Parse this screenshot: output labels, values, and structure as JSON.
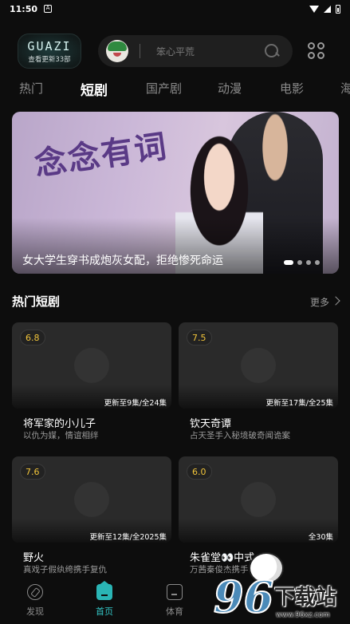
{
  "status_bar": {
    "time": "11:50",
    "notif_letter": "A"
  },
  "header": {
    "logo_text": "GUAZI",
    "logo_sub": "查看更新33部",
    "search_placeholder": "笨心平荒"
  },
  "tabs": [
    {
      "label": "热门",
      "active": false
    },
    {
      "label": "短剧",
      "active": true
    },
    {
      "label": "国产剧",
      "active": false
    },
    {
      "label": "动漫",
      "active": false
    },
    {
      "label": "电影",
      "active": false
    },
    {
      "label": "海",
      "active": false
    }
  ],
  "banner": {
    "art_title": "念念有词",
    "caption": "女大学生穿书成炮灰女配，拒绝惨死命运",
    "slide_count": 4,
    "active_slide": 1
  },
  "section": {
    "title": "热门短剧",
    "more": "更多"
  },
  "cards": [
    {
      "score": "6.8",
      "episodes": "更新至9集/全24集",
      "title": "将军家的小儿子",
      "desc": "以仇为媒，情谊相绊"
    },
    {
      "score": "7.5",
      "episodes": "更新至17集/全25集",
      "title": "钦天奇谭",
      "desc": "占天圣手入秘境破奇闻诡案"
    },
    {
      "score": "7.6",
      "episodes": "更新至12集/全2025集",
      "title": "野火",
      "desc": "真戏子假纨绔携手复仇"
    },
    {
      "score": "6.0",
      "episodes": "全30集",
      "title": "朱雀堂👀中式",
      "desc": "万茜秦俊杰携手"
    }
  ],
  "bottom_nav": [
    {
      "label": "发现",
      "icon": "compass-icon",
      "active": false
    },
    {
      "label": "首页",
      "icon": "home-icon",
      "active": true
    },
    {
      "label": "体育",
      "icon": "sport-icon",
      "active": false
    }
  ],
  "watermark": {
    "number": "96",
    "text": "下载站",
    "url": "www.96xz.com"
  }
}
